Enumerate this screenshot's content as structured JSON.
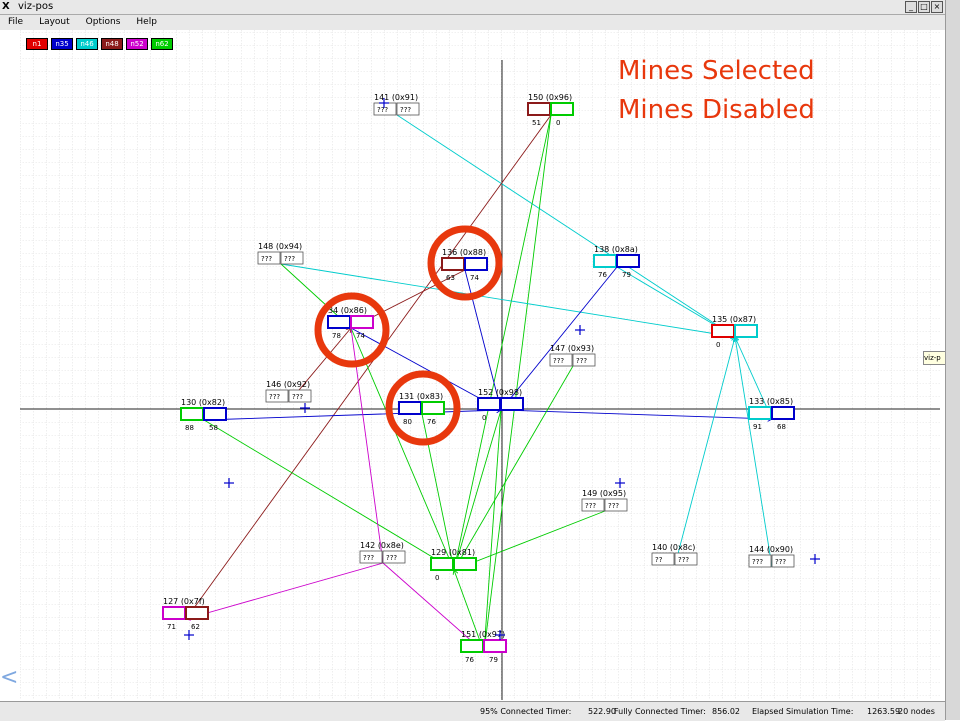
{
  "window": {
    "title": "viz-pos",
    "logo": "X",
    "buttons": [
      "_",
      "□",
      "×"
    ]
  },
  "menu": [
    "File",
    "Layout",
    "Options",
    "Help"
  ],
  "legend": [
    {
      "label": "n1",
      "color": "#e00000"
    },
    {
      "label": "n35",
      "color": "#0000cc"
    },
    {
      "label": "n46",
      "color": "#00cccc"
    },
    {
      "label": "n48",
      "color": "#8b1a1a"
    },
    {
      "label": "n52",
      "color": "#cc00cc"
    },
    {
      "label": "n62",
      "color": "#00cc00"
    }
  ],
  "annotations": {
    "line1": "Mines Selected",
    "line2": "Mines Disabled"
  },
  "tooltip": "viz-p",
  "status": {
    "connected95": "95% Connected Timer:",
    "connected95_val": "522.90",
    "fully": "Fully Connected Timer:",
    "fully_val": "856.02",
    "elapsed": "Elapsed Simulation Time:",
    "elapsed_val": "1263.59",
    "nodes": "20 nodes"
  },
  "nodes": [
    {
      "id": "141",
      "title": "141 (0x91)",
      "left": "???",
      "right": "???",
      "lc": "#fff",
      "rc": "#fff"
    },
    {
      "id": "150",
      "title": "150 (0x96)",
      "left": "51",
      "right": "0",
      "lc": "#8b1a1a",
      "rc": "#00cc00"
    },
    {
      "id": "148",
      "title": "148 (0x94)",
      "left": "???",
      "right": "???",
      "lc": "#fff",
      "rc": "#fff"
    },
    {
      "id": "136",
      "title": "136 (0x88)",
      "left": "63",
      "right": "74",
      "lc": "#8b1a1a",
      "rc": "#0000cc"
    },
    {
      "id": "138",
      "title": "138 (0x8a)",
      "left": "76",
      "right": "79",
      "lc": "#00cccc",
      "rc": "#0000cc"
    },
    {
      "id": "134",
      "title": "34 (0x86)",
      "left": "78",
      "right": "74",
      "lc": "#0000cc",
      "rc": "#cc00cc"
    },
    {
      "id": "135",
      "title": "135 (0x87)",
      "left": "0",
      "right": "",
      "lc": "#e00000",
      "rc": "#00cccc"
    },
    {
      "id": "147",
      "title": "147 (0x93)",
      "left": "???",
      "right": "???",
      "lc": "#fff",
      "rc": "#fff"
    },
    {
      "id": "146",
      "title": "146 (0x92)",
      "left": "???",
      "right": "???",
      "lc": "#fff",
      "rc": "#fff"
    },
    {
      "id": "130",
      "title": "130 (0x82)",
      "left": "88",
      "right": "58",
      "lc": "#00cc00",
      "rc": "#0000cc"
    },
    {
      "id": "131",
      "title": "131 (0x83)",
      "left": "80",
      "right": "76",
      "lc": "#0000cc",
      "rc": "#00cc00"
    },
    {
      "id": "152",
      "title": "152 (0x98)",
      "left": "0",
      "right": "",
      "lc": "#0000cc",
      "rc": "#0000cc"
    },
    {
      "id": "133",
      "title": "133 (0x85)",
      "left": "91",
      "right": "68",
      "lc": "#00cccc",
      "rc": "#0000cc"
    },
    {
      "id": "149",
      "title": "149 (0x95)",
      "left": "???",
      "right": "???",
      "lc": "#fff",
      "rc": "#fff"
    },
    {
      "id": "142",
      "title": "142 (0x8e)",
      "left": "???",
      "right": "???",
      "lc": "#fff",
      "rc": "#fff"
    },
    {
      "id": "129",
      "title": "129 (0x81)",
      "left": "0",
      "right": "",
      "lc": "#00cc00",
      "rc": "#00cc00"
    },
    {
      "id": "140",
      "title": "140 (0x8c)",
      "left": "??",
      "right": "???",
      "lc": "#fff",
      "rc": "#fff"
    },
    {
      "id": "144",
      "title": "144 (0x90)",
      "left": "???",
      "right": "???",
      "lc": "#fff",
      "rc": "#fff"
    },
    {
      "id": "127",
      "title": "127 (0x7f)",
      "left": "71",
      "right": "62",
      "lc": "#cc00cc",
      "rc": "#8b1a1a"
    },
    {
      "id": "151",
      "title": "151 (0x97)",
      "left": "76",
      "right": "79",
      "lc": "#00cc00",
      "rc": "#cc00cc"
    }
  ]
}
